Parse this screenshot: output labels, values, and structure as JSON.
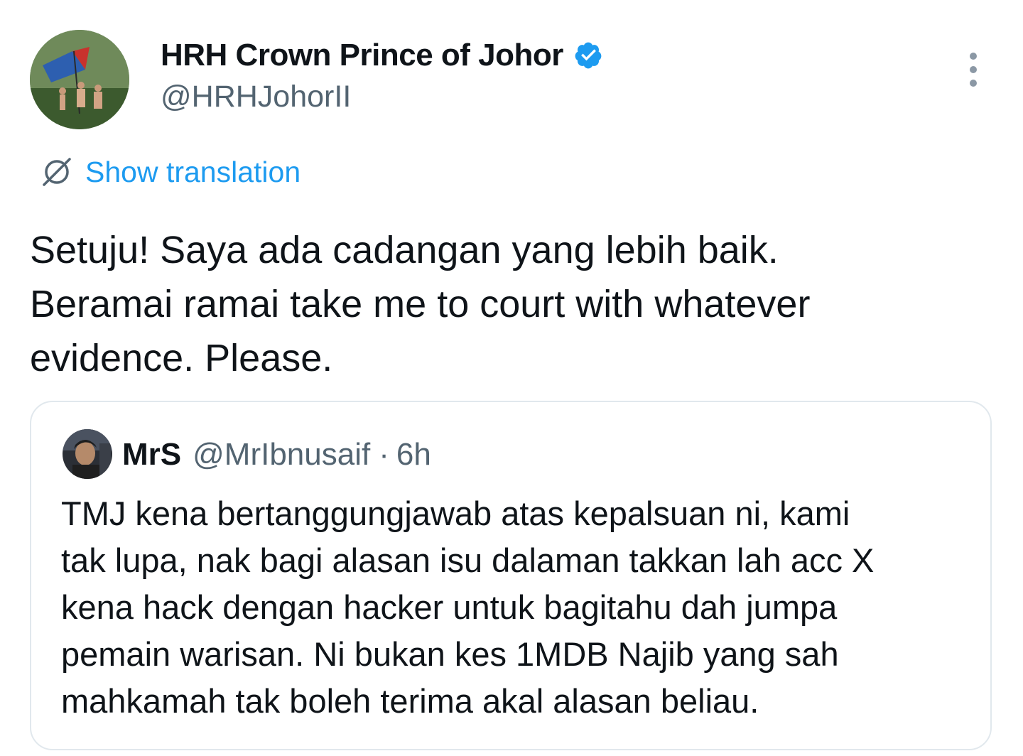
{
  "author": {
    "display_name": "HRH Crown Prince of Johor",
    "handle": "@HRHJohorII",
    "verified": true,
    "avatar": "avatar-flag-photo"
  },
  "actions": {
    "more_icon": "more-vertical-icon"
  },
  "translate": {
    "icon": "globe-icon",
    "label": "Show translation"
  },
  "tweet": {
    "lines": [
      "Setuju! Saya ada cadangan yang lebih baik.",
      "Beramai ramai take me to court with whatever",
      "evidence. Please."
    ]
  },
  "quote": {
    "display_name": "MrS",
    "handle": "@MrIbnusaif",
    "separator": "·",
    "time": "6h",
    "avatar": "avatar-man-photo",
    "lines": [
      "TMJ kena bertanggungjawab atas kepalsuan ni, kami",
      "tak lupa, nak bagi alasan isu dalaman takkan lah acc X",
      "kena hack dengan hacker untuk bagitahu dah jumpa",
      "pemain warisan. Ni bukan kes 1MDB Najib yang sah",
      "mahkamah tak boleh terima akal alasan beliau."
    ]
  },
  "colors": {
    "accent": "#1d9bf0",
    "text": "#0f1419",
    "secondary": "#536471",
    "border": "#e1e8ed"
  }
}
